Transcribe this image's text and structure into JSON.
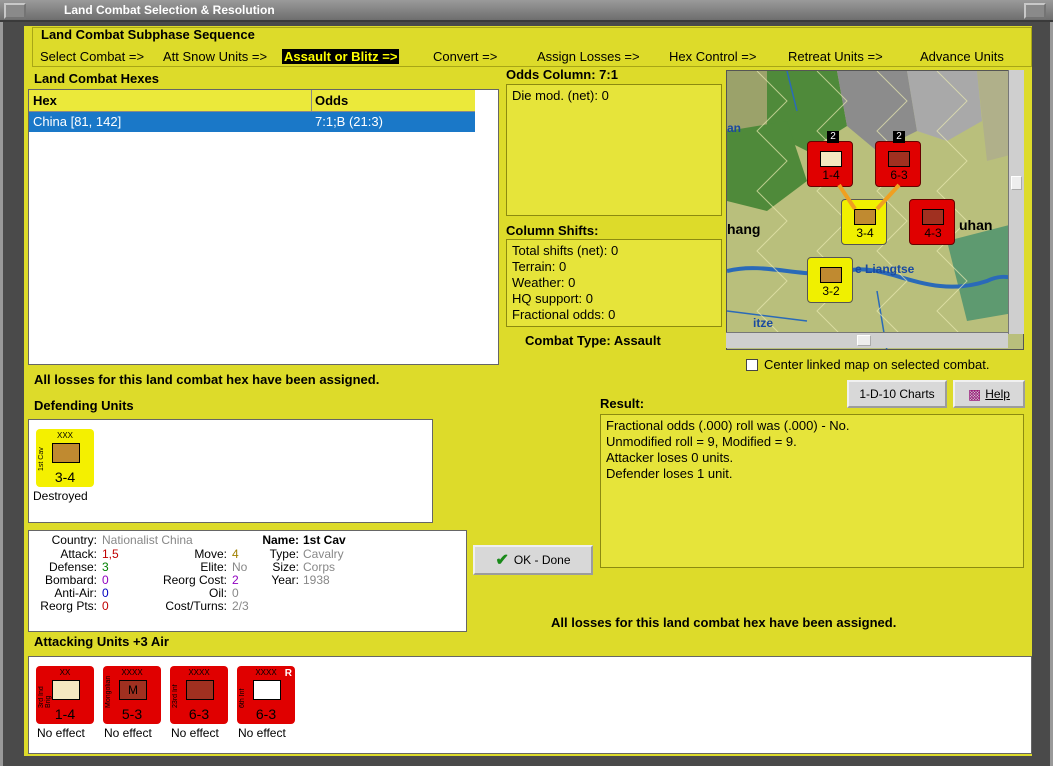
{
  "window": {
    "title": "Land Combat Selection & Resolution"
  },
  "subphase": {
    "title": "Land Combat Subphase Sequence",
    "steps": [
      "Select Combat =>",
      "Att Snow Units =>",
      "Assault or Blitz =>",
      "Convert =>",
      "Assign Losses =>",
      "Hex Control =>",
      "Retreat Units =>",
      "Advance Units"
    ],
    "active_index": 2
  },
  "hexes": {
    "title": "Land Combat Hexes",
    "headers": [
      "Hex",
      "Odds"
    ],
    "rows": [
      {
        "hex": "China [81, 142]",
        "odds": "7:1;B (21:3)"
      }
    ]
  },
  "odds": {
    "title": "Odds Column: 7:1",
    "die_mod": "Die mod. (net): 0"
  },
  "shifts": {
    "title": "Column Shifts:",
    "lines": [
      "Total shifts (net): 0",
      "Terrain: 0",
      "Weather: 0",
      "HQ support: 0",
      "Fractional odds: 0"
    ]
  },
  "combat_type": "Combat Type:  Assault",
  "map": {
    "labels": [
      "an",
      "hang",
      "uhan",
      "e Liangtse",
      "itze"
    ],
    "counters": [
      {
        "size": "XX",
        "value": "1-4",
        "color": "#e00000"
      },
      {
        "size": "XXXX",
        "value": "6-3",
        "color": "#e00000"
      },
      {
        "size": "XXX",
        "value": "3-4",
        "color": "#f0f000"
      },
      {
        "size": "XXXX",
        "value": "4-3",
        "color": "#e00000"
      },
      {
        "size": "XXXX",
        "value": "3-2",
        "color": "#f0f000"
      }
    ],
    "stack_badges": [
      "2",
      "2"
    ],
    "center_checkbox": "Center linked map on selected combat."
  },
  "losses_msg_top": "All losses for this land combat hex have been assigned.",
  "buttons": {
    "charts": "1-D-10 Charts",
    "help": "Help",
    "ok": "OK - Done"
  },
  "defending": {
    "title": "Defending Units",
    "units": [
      {
        "size": "XXX",
        "name": "1st Cav",
        "value": "3-4",
        "status": "Destroyed",
        "color": "#f4f000"
      }
    ]
  },
  "stats": {
    "country_label": "Country:",
    "country": "Nationalist China",
    "attack_label": "Attack:",
    "attack": "1,5",
    "defense_label": "Defense:",
    "defense": "3",
    "bombard_label": "Bombard:",
    "bombard": "0",
    "antiair_label": "Anti-Air:",
    "antiair": "0",
    "reorg_label": "Reorg Pts:",
    "reorg": "0",
    "move_label": "Move:",
    "move": "4",
    "elite_label": "Elite:",
    "elite": "No",
    "reorgcost_label": "Reorg Cost:",
    "reorgcost": "2",
    "oil_label": "Oil:",
    "oil": "0",
    "costturns_label": "Cost/Turns:",
    "costturns": "2/3",
    "name_label": "Name:",
    "name": "1st Cav",
    "type_label": "Type:",
    "type": "Cavalry",
    "size_label": "Size:",
    "size": "Corps",
    "year_label": "Year:",
    "year": "1938"
  },
  "result": {
    "title": "Result:",
    "lines": [
      "Fractional odds (.000) roll was (.000)  -  No.",
      "Unmodified roll = 9, Modified = 9.",
      "Attacker loses 0 units.",
      "Defender loses 1 unit."
    ]
  },
  "losses_msg_bottom": "All losses for this land combat hex have been assigned.",
  "attacking": {
    "title": "Attacking Units +3 Air",
    "units": [
      {
        "size": "XX",
        "name": "3rd Ind Brig",
        "value": "1-4",
        "status": "No effect",
        "symbol": ""
      },
      {
        "size": "XXXX",
        "name": "Mongolian",
        "value": "5-3",
        "status": "No effect",
        "symbol": "M"
      },
      {
        "size": "XXXX",
        "name": "23rd Inf",
        "value": "6-3",
        "status": "No effect",
        "symbol": ""
      },
      {
        "size": "XXXX",
        "name": "6th Inf",
        "value": "6-3",
        "status": "No effect",
        "symbol": "",
        "badge": "R"
      }
    ]
  }
}
